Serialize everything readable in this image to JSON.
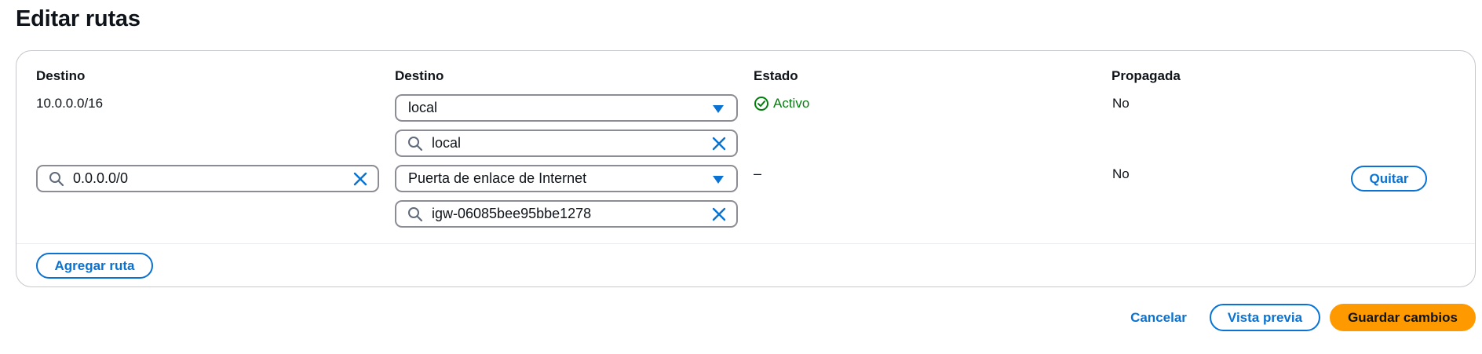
{
  "page": {
    "title": "Editar rutas"
  },
  "columns": {
    "destination": "Destino",
    "target": "Destino",
    "status": "Estado",
    "propagated": "Propagada"
  },
  "routes": [
    {
      "destination": "10.0.0.0/16",
      "target_select": "local",
      "target_search": "local",
      "status": "Activo",
      "propagated": "No"
    },
    {
      "destination_search": "0.0.0.0/0",
      "target_select": "Puerta de enlace de Internet",
      "target_search": "igw-06085bee95bbe1278",
      "status": "–",
      "propagated": "No",
      "remove_label": "Quitar"
    }
  ],
  "panel": {
    "add_route_label": "Agregar ruta"
  },
  "footer": {
    "cancel_label": "Cancelar",
    "preview_label": "Vista previa",
    "save_label": "Guardar cambios"
  },
  "icons": {
    "search": "search-icon",
    "clear": "close-icon",
    "dropdown": "caret-down-icon",
    "status_ok": "check-circle-icon"
  },
  "colors": {
    "accent": "#0972d3",
    "success": "#037f0c",
    "primary_button": "#ff9900",
    "border": "#8c8c94"
  }
}
